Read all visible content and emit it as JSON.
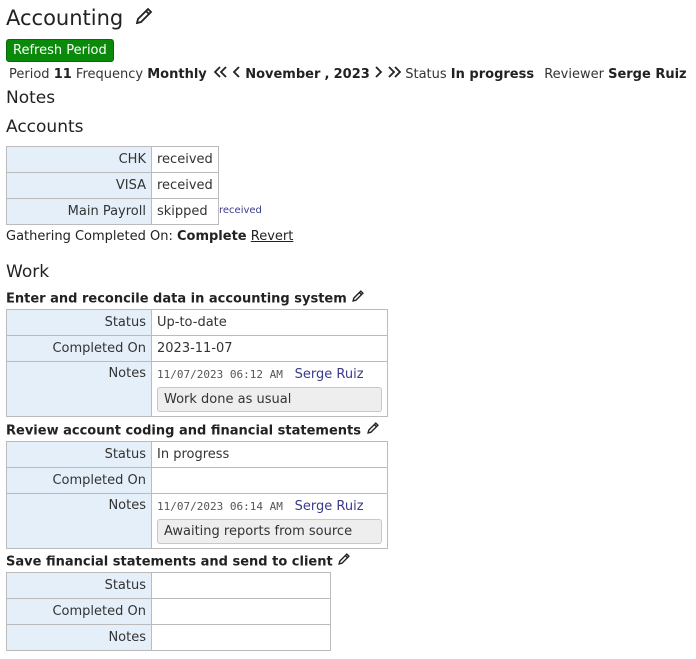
{
  "page": {
    "title": "Accounting"
  },
  "toolbar": {
    "refresh_label": "Refresh Period"
  },
  "period": {
    "period_label": "Period",
    "period_value": "11",
    "frequency_label": "Frequency",
    "frequency_value": "Monthly",
    "month": "November",
    "comma": ",",
    "year": "2023",
    "status_label": "Status",
    "status_value": "In progress",
    "reviewer_label": "Reviewer",
    "reviewer_value": "Serge Ruiz"
  },
  "sections": {
    "notes": "Notes",
    "accounts": "Accounts",
    "work": "Work"
  },
  "accounts": [
    {
      "name": "CHK",
      "status": "received",
      "alt": ""
    },
    {
      "name": "VISA",
      "status": "received",
      "alt": ""
    },
    {
      "name": "Main Payroll",
      "status": "skipped",
      "alt": "received"
    }
  ],
  "gathering": {
    "label": "Gathering Completed On:",
    "value": "Complete",
    "revert": "Revert"
  },
  "tasks": [
    {
      "title": "Enter and reconcile data in accounting system",
      "status_label": "Status",
      "status": "Up-to-date",
      "completed_label": "Completed On",
      "completed": "2023-11-07",
      "notes_label": "Notes",
      "note_time": "11/07/2023 06:12 AM",
      "note_author": "Serge Ruiz",
      "note_text": "Work done as usual"
    },
    {
      "title": "Review account coding and financial statements",
      "status_label": "Status",
      "status": "In progress",
      "completed_label": "Completed On",
      "completed": "",
      "notes_label": "Notes",
      "note_time": "11/07/2023 06:14 AM",
      "note_author": "Serge Ruiz",
      "note_text": "Awaiting reports from source"
    },
    {
      "title": "Save financial statements and send to client",
      "status_label": "Status",
      "status": "",
      "completed_label": "Completed On",
      "completed": "",
      "notes_label": "Notes"
    }
  ],
  "icons": {
    "edit": "pencil-icon",
    "first": "double-chevron-left-icon",
    "prev": "chevron-left-icon",
    "next": "chevron-right-icon",
    "last": "double-chevron-right-icon"
  },
  "colors": {
    "refresh_bg": "#0a8a0a",
    "key_cell_bg": "#e5eff9",
    "link": "#3a3a8a"
  }
}
